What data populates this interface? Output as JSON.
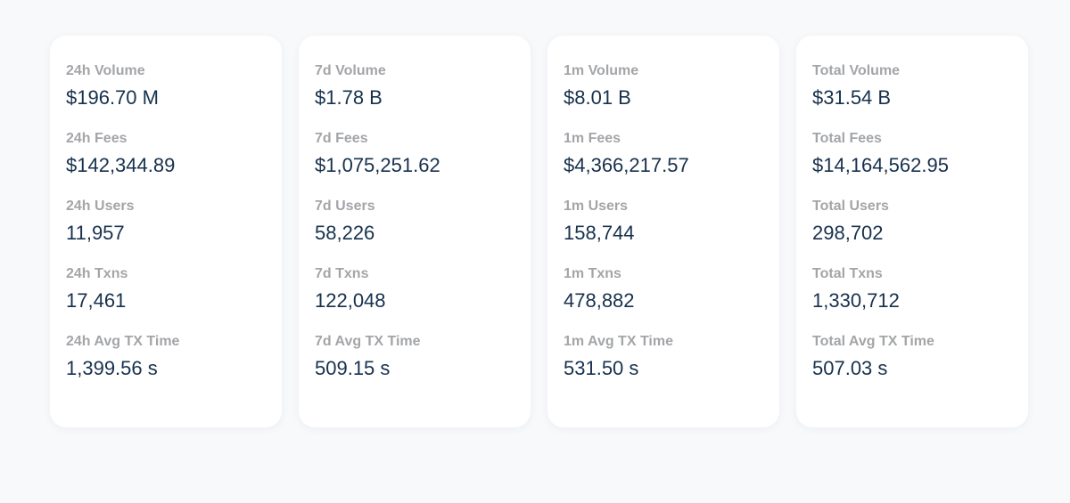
{
  "cards": [
    {
      "stats": [
        {
          "label": "24h Volume",
          "value": "$196.70 M"
        },
        {
          "label": "24h Fees",
          "value": "$142,344.89"
        },
        {
          "label": "24h Users",
          "value": "11,957"
        },
        {
          "label": "24h Txns",
          "value": "17,461"
        },
        {
          "label": "24h Avg TX Time",
          "value": "1,399.56 s"
        }
      ]
    },
    {
      "stats": [
        {
          "label": "7d Volume",
          "value": "$1.78 B"
        },
        {
          "label": "7d Fees",
          "value": "$1,075,251.62"
        },
        {
          "label": "7d Users",
          "value": "58,226"
        },
        {
          "label": "7d Txns",
          "value": "122,048"
        },
        {
          "label": "7d Avg TX Time",
          "value": "509.15 s"
        }
      ]
    },
    {
      "stats": [
        {
          "label": "1m Volume",
          "value": "$8.01 B"
        },
        {
          "label": "1m Fees",
          "value": "$4,366,217.57"
        },
        {
          "label": "1m Users",
          "value": "158,744"
        },
        {
          "label": "1m Txns",
          "value": "478,882"
        },
        {
          "label": "1m Avg TX Time",
          "value": "531.50 s"
        }
      ]
    },
    {
      "stats": [
        {
          "label": "Total Volume",
          "value": "$31.54 B"
        },
        {
          "label": "Total Fees",
          "value": "$14,164,562.95"
        },
        {
          "label": "Total Users",
          "value": "298,702"
        },
        {
          "label": "Total Txns",
          "value": "1,330,712"
        },
        {
          "label": "Total Avg TX Time",
          "value": "507.03 s"
        }
      ]
    }
  ]
}
